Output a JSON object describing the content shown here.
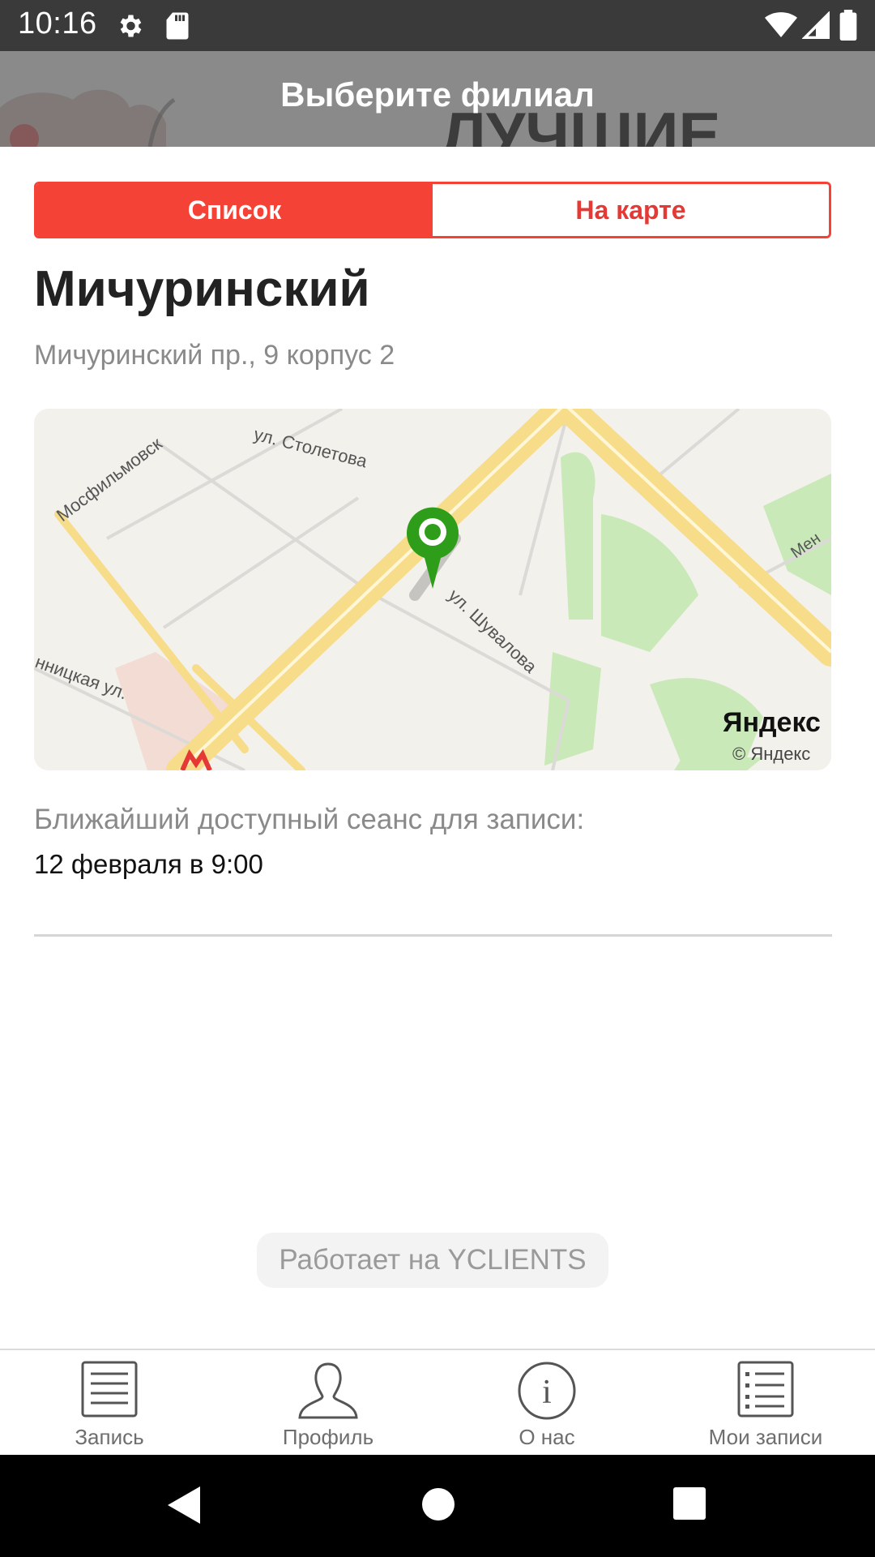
{
  "status_bar": {
    "time": "10:16",
    "icons": [
      "gear-icon",
      "sd-card-icon",
      "wifi-icon",
      "signal-icon",
      "battery-icon"
    ]
  },
  "header": {
    "title": "Выберите филиал"
  },
  "view_toggle": {
    "list_label": "Список",
    "map_label": "На карте",
    "selected": "list"
  },
  "branch": {
    "name": "Мичуринский",
    "address": "Мичуринский пр., 9 корпус 2"
  },
  "map": {
    "streets": [
      "ул. Столетова",
      "Мосфильмовск",
      "ул. Шувалова",
      "нницкая ул.",
      "Мен"
    ],
    "logo": "Яндекс",
    "copyright": "© Яндекс",
    "metro_icon": "metro-icon"
  },
  "next_session": {
    "label": "Ближайший доступный сеанс для записи:",
    "value": "12 февраля в 9:00"
  },
  "powered_by": "Работает на YCLIENTS",
  "bottom_nav": {
    "items": [
      {
        "label": "Запись",
        "icon": "document-icon"
      },
      {
        "label": "Профиль",
        "icon": "person-icon"
      },
      {
        "label": "О нас",
        "icon": "info-icon"
      },
      {
        "label": "Мои записи",
        "icon": "list-icon"
      }
    ]
  },
  "colors": {
    "accent": "#f44336",
    "status_bar": "#3a3a3a",
    "header": "#8a8a8a",
    "pin": "#2e9e1a"
  }
}
